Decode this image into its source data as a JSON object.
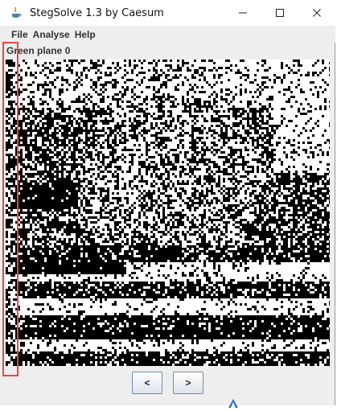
{
  "window": {
    "title": "StegSolve 1.3 by Caesum",
    "icon": "java-cup-icon",
    "controls": [
      "minimize-icon",
      "maximize-icon",
      "close-icon"
    ]
  },
  "menu": [
    "File",
    "Analyse",
    "Help"
  ],
  "panel": {
    "label": "Green plane 0"
  },
  "navigation": {
    "prev_label": "<",
    "next_label": ">"
  },
  "colors": {
    "highlight": "#e8474a",
    "background": "#eeeeee"
  }
}
